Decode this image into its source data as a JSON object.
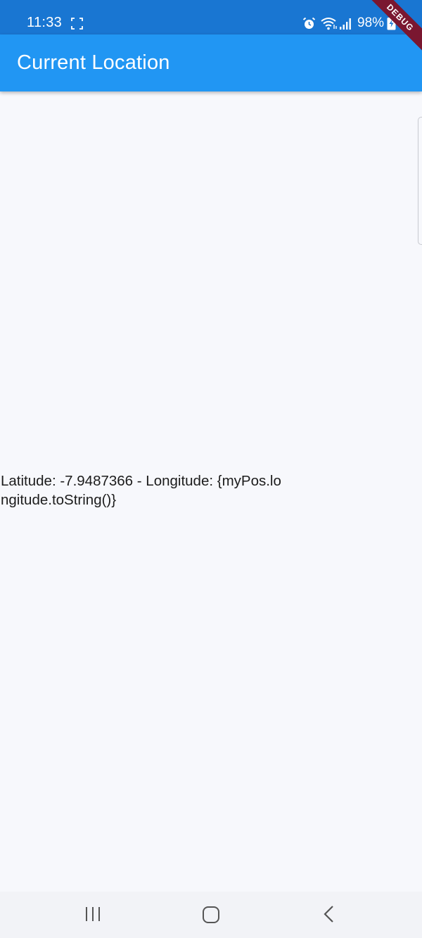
{
  "status_bar": {
    "time": "11:33",
    "battery": "98%",
    "icons": [
      "screenshot-icon",
      "alarm-icon",
      "wifi-icon",
      "signal-icon",
      "battery-charging-icon"
    ],
    "color": "#1976d2"
  },
  "app_bar": {
    "title": "Current Location",
    "color": "#2196f3"
  },
  "debug_banner": {
    "label": "DEBUG",
    "color": "#7a1730"
  },
  "content": {
    "location_text": "Latitude: -7.9487366 - Longitude: {myPos.longitude.toString()}"
  },
  "nav_bar": {
    "icons": [
      "recent-apps-icon",
      "home-icon",
      "back-icon"
    ]
  }
}
